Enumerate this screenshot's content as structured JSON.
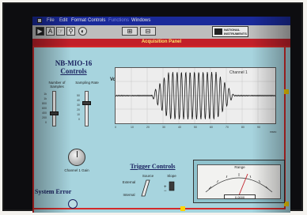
{
  "menu": {
    "items": [
      "File",
      "Edit",
      "Format",
      "Controls",
      "Functions",
      "Windows"
    ]
  },
  "toolbar": {
    "logo_text": "NATIONAL INSTRUMENTS"
  },
  "window": {
    "title": "Acquisition Panel"
  },
  "controls": {
    "title_line1": "NB-MIO-16",
    "title_line2": "Controls",
    "samples_label": "Number of Samples",
    "rate_label": "Sampling Rate",
    "samples_scale": [
      "1k",
      "1k",
      "800",
      "600",
      "400",
      "200",
      "0"
    ],
    "rate_scale": [
      "50",
      "40",
      "30",
      "20",
      "10",
      "0"
    ],
    "channel_label": "Channel 1 Gain",
    "system_error_label": "System   Error"
  },
  "graph": {
    "channel_label": "Channel 1",
    "y_label": "Volts",
    "x_ticks": [
      "0",
      "10",
      "20",
      "30",
      "40",
      "50",
      "60",
      "70",
      "80",
      "90"
    ],
    "x_unit": "msec"
  },
  "trigger": {
    "title": "Trigger Controls",
    "source_label": "Source",
    "slope_label": "Slope",
    "option_external": "External",
    "option_internal": "Internal"
  },
  "meter": {
    "label": "Range",
    "readout": "0.0000"
  },
  "colors": {
    "panel_bg": "#a7d4de",
    "title_bar": "#c2202a",
    "menu_bar": "#1a2a9a",
    "accent_yellow": "#ffd400"
  }
}
